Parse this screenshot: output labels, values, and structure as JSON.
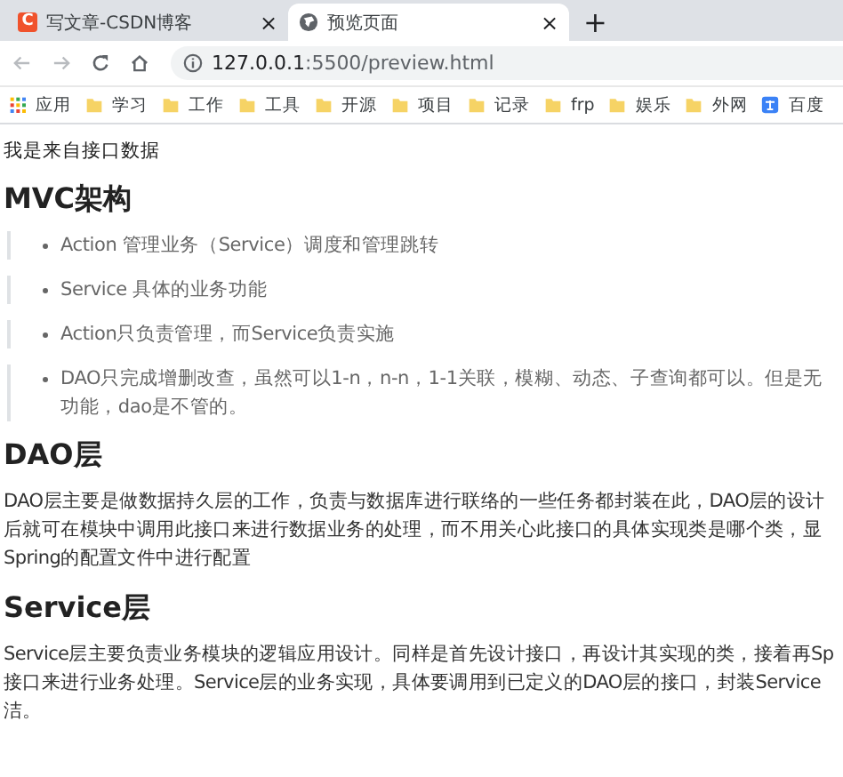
{
  "tabs": [
    {
      "title": "写文章-CSDN博客",
      "selected": false,
      "kind": "logo",
      "logo_text": "C",
      "close": "×"
    },
    {
      "title": "预览页面",
      "selected": true,
      "kind": "globe",
      "close": "×"
    }
  ],
  "new_tab": "+",
  "address": {
    "host": "127.0.0.1",
    "path": ":5500/preview.html"
  },
  "bookmarks": [
    {
      "label": "应用",
      "kind": "apps"
    },
    {
      "label": "学习",
      "kind": "folder"
    },
    {
      "label": "工作",
      "kind": "folder"
    },
    {
      "label": "工具",
      "kind": "folder"
    },
    {
      "label": "开源",
      "kind": "folder"
    },
    {
      "label": "项目",
      "kind": "folder"
    },
    {
      "label": "记录",
      "kind": "folder"
    },
    {
      "label": "frp",
      "kind": "folder"
    },
    {
      "label": "娱乐",
      "kind": "folder"
    },
    {
      "label": "外网",
      "kind": "folder"
    },
    {
      "label": "百度",
      "kind": "translate"
    }
  ],
  "page": {
    "intro": "我是来自接口数据",
    "sections": [
      {
        "heading": "MVC架构",
        "kind": "quotes",
        "items": [
          [
            "Action 管理业务（Service）调度和管理跳转"
          ],
          [
            "Service 具体的业务功能"
          ],
          [
            "Action只负责管理，而Service负责实施"
          ],
          [
            "DAO只完成增删改查，虽然可以1-n，n-n，1-1关联，模糊、动态、子查询都可以。但是无",
            "功能，dao是不管的。"
          ]
        ]
      },
      {
        "heading": "DAO层",
        "kind": "paragraph",
        "lines": [
          "DAO层主要是做数据持久层的工作，负责与数据库进行联络的一些任务都封装在此，DAO层的设计",
          "后就可在模块中调用此接口来进行数据业务的处理，而不用关心此接口的具体实现类是哪个类，显",
          "Spring的配置文件中进行配置"
        ]
      },
      {
        "heading": "Service层",
        "kind": "paragraph",
        "lines": [
          "Service层主要负责业务模块的逻辑应用设计。同样是首先设计接口，再设计其实现的类，接着再Sp",
          "接口来进行业务处理。Service层的业务实现，具体要调用到已定义的DAO层的接口，封装Service",
          "洁。"
        ]
      }
    ]
  }
}
